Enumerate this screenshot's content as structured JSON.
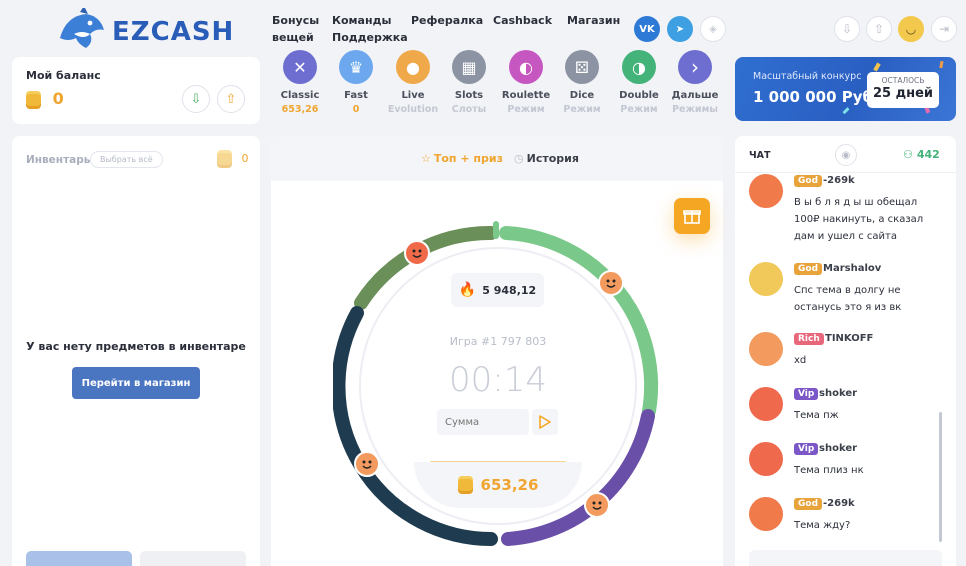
{
  "header": {
    "logo": "EZCASH",
    "nav": [
      {
        "label": "Бонусы вещей"
      },
      {
        "label": "Команды Поддержка"
      },
      {
        "label": "Рефералка"
      },
      {
        "label": "Cashback"
      },
      {
        "label": "Магазин"
      }
    ],
    "social": {
      "vk": "VK",
      "tg": "➤"
    }
  },
  "balance": {
    "title": "Мой баланс",
    "value": "0"
  },
  "modes": [
    {
      "label": "Classic",
      "sub": "653,26",
      "color": "#6d6ed0",
      "icon": "✕"
    },
    {
      "label": "Fast",
      "sub": "0",
      "color": "#6da8ee",
      "icon": "♛"
    },
    {
      "label": "Live",
      "sub": "Evolution",
      "color": "#f0a94a",
      "icon": "●"
    },
    {
      "label": "Slots",
      "sub": "Слоты",
      "color": "#8c93a3",
      "icon": "▦"
    },
    {
      "label": "Roulette",
      "sub": "Режим",
      "color": "#c757c0",
      "icon": "◐"
    },
    {
      "label": "Dice",
      "sub": "Режим",
      "color": "#8c93a3",
      "icon": "⚄"
    },
    {
      "label": "Double",
      "sub": "Режим",
      "color": "#43b37a",
      "icon": "◑"
    },
    {
      "label": "Дальше",
      "sub": "Режимы",
      "color": "#6d6ed0",
      "icon": "›"
    }
  ],
  "promo": {
    "title": "Масштабный конкурс",
    "amount": "1 000 000 Руб",
    "remain_label": "ОСТАЛОСЬ",
    "remain_value": "25 дней"
  },
  "inventory": {
    "title": "Инвентарь",
    "select_all": "Выбрать всё",
    "count": "0",
    "empty_text": "У вас нету предметов в инвентаре",
    "shop_button": "Перейти в магазин"
  },
  "game": {
    "tabs": {
      "top": "Топ + приз",
      "history": "История"
    },
    "jackpot": "5 948,12",
    "game_number": "Игра #1 797 803",
    "timer": "00:14",
    "amount_placeholder": "Сумма",
    "bank": "653,26"
  },
  "chat": {
    "title": "ЧАТ",
    "online": "442",
    "messages": [
      {
        "badge": "God",
        "badge_color": "#e8a33a",
        "user": "-269k",
        "text": "В ы б л я д ы ш обещал 100₽ накинуть, а сказал дам и ушел с сайта",
        "avatar": "#f07a4a"
      },
      {
        "badge": "God",
        "badge_color": "#e8a33a",
        "user": "Marshalov",
        "text": "Спс тема в долгу не останусь это я из вк",
        "avatar": "#f0c95a"
      },
      {
        "badge": "Rich",
        "badge_color": "#e8677a",
        "user": "TINKOFF",
        "text": "xd",
        "avatar": "#f39a5e"
      },
      {
        "badge": "Vip",
        "badge_color": "#7b57c7",
        "user": "shoker",
        "text": "Тема пж",
        "avatar": "#ef6a4d"
      },
      {
        "badge": "Vip",
        "badge_color": "#7b57c7",
        "user": "shoker",
        "text": "Тема плиз нк",
        "avatar": "#ef6a4d"
      },
      {
        "badge": "God",
        "badge_color": "#e8a33a",
        "user": "-269k",
        "text": "Тема жду?",
        "avatar": "#f07a4a"
      }
    ]
  }
}
